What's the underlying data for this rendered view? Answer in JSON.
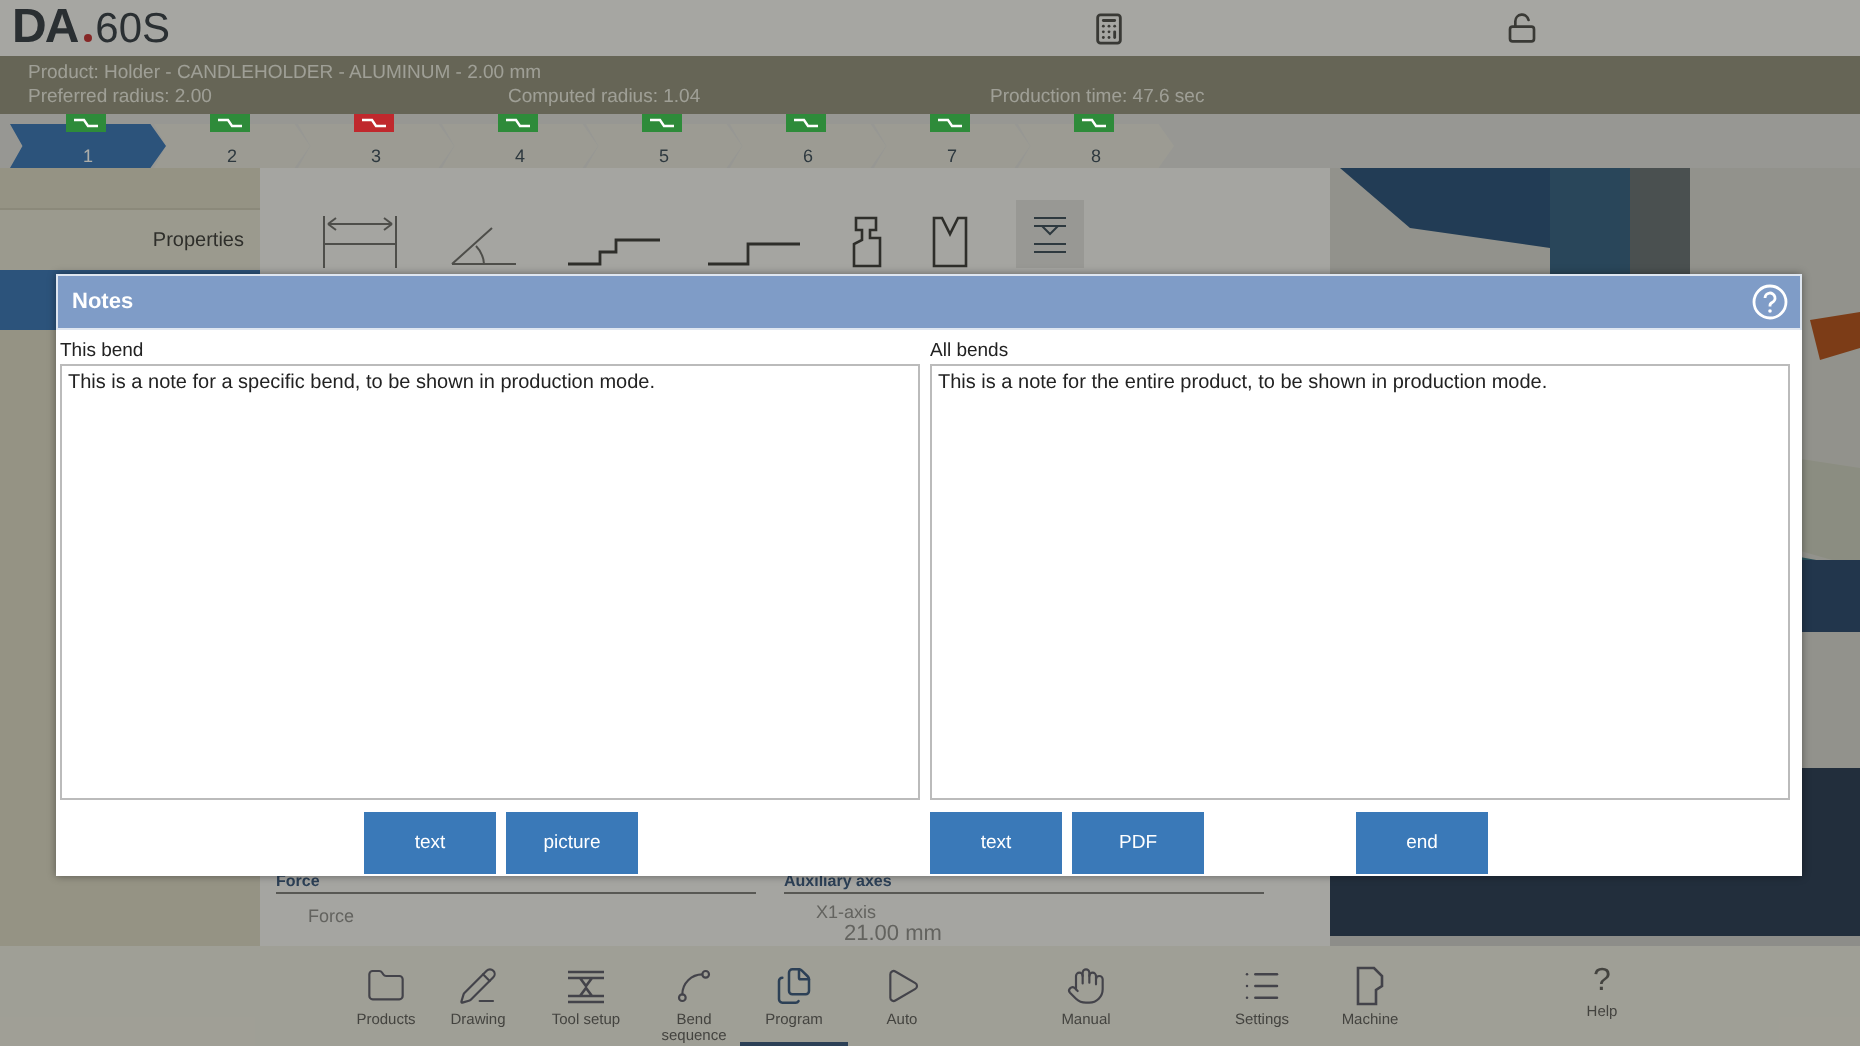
{
  "logo": {
    "brand": "DA",
    "model": "60S"
  },
  "info": {
    "product": "Product: Holder - CANDLEHOLDER - ALUMINUM - 2.00 mm",
    "preferred_radius": "Preferred radius: 2.00",
    "computed_radius": "Computed radius: 1.04",
    "production_time": "Production time: 47.6 sec"
  },
  "bends": [
    {
      "label": "1",
      "selected": true,
      "color": "#2e8b3a"
    },
    {
      "label": "2",
      "selected": false,
      "color": "#2e8b3a"
    },
    {
      "label": "3",
      "selected": false,
      "color": "#c0282d"
    },
    {
      "label": "4",
      "selected": false,
      "color": "#2e8b3a"
    },
    {
      "label": "5",
      "selected": false,
      "color": "#2e8b3a"
    },
    {
      "label": "6",
      "selected": false,
      "color": "#2e8b3a"
    },
    {
      "label": "7",
      "selected": false,
      "color": "#2e8b3a"
    },
    {
      "label": "8",
      "selected": false,
      "color": "#2e8b3a"
    }
  ],
  "sidebar": {
    "items": [
      {
        "label": "Properties",
        "selected": false
      }
    ]
  },
  "panel": {
    "force_heading": "Force",
    "force_label": "Force",
    "aux_heading": "Auxiliary axes",
    "x1_label": "X1-axis",
    "x1_value": "21.00 mm"
  },
  "nav": [
    {
      "label": "Products",
      "kind": "folder",
      "selected": false
    },
    {
      "label": "Drawing",
      "kind": "drawing",
      "selected": false
    },
    {
      "label": "Tool setup",
      "kind": "tools",
      "selected": false
    },
    {
      "label": "Bend sequence",
      "kind": "sequence",
      "selected": false
    },
    {
      "label": "Program",
      "kind": "program",
      "selected": true
    },
    {
      "label": "Auto",
      "kind": "auto",
      "selected": false
    },
    {
      "label": "Manual",
      "kind": "manual",
      "selected": false
    },
    {
      "label": "Settings",
      "kind": "settings",
      "selected": false
    },
    {
      "label": "Machine",
      "kind": "machine",
      "selected": false
    },
    {
      "label": "Help",
      "kind": "help",
      "selected": false,
      "glyph": "?"
    }
  ],
  "dialog": {
    "title": "Notes",
    "columns": [
      {
        "label": "This bend",
        "value": "This is a note for a specific bend, to be shown in production mode.",
        "buttons": [
          "text",
          "picture"
        ]
      },
      {
        "label": "All bends",
        "value": "This is a note for the entire product, to be shown in production mode.",
        "buttons": [
          "text",
          "PDF"
        ]
      }
    ],
    "end_button": "end"
  }
}
